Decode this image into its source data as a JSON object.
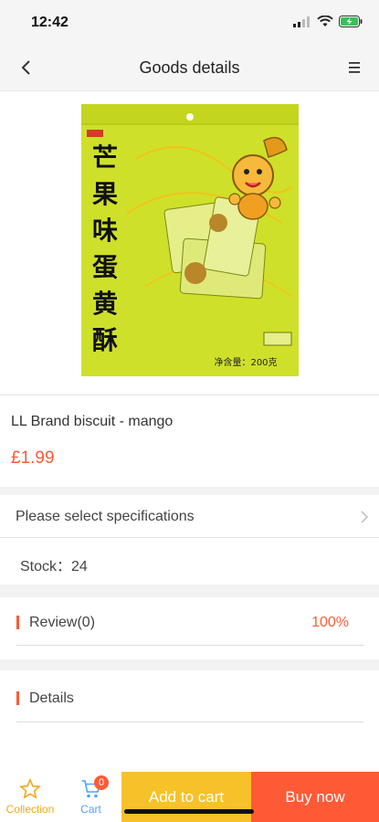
{
  "status_bar": {
    "time": "12:42"
  },
  "navbar": {
    "title": "Goods details",
    "back_icon": "chevron-left-icon",
    "menu_icon": "menu-icon"
  },
  "product": {
    "image_text": {
      "vertical_name": [
        "芒",
        "果",
        "味",
        "蛋",
        "黄",
        "酥"
      ],
      "weight": "净含量：200克"
    },
    "name": "LL Brand biscuit - mango",
    "price": "£1.99"
  },
  "specs": {
    "label": "Please select specifications",
    "stock": "Stock：24"
  },
  "review": {
    "label": "Review(0)",
    "rate": "100%"
  },
  "details": {
    "label": "Details"
  },
  "bottom_bar": {
    "collection_label": "Collection",
    "cart_label": "Cart",
    "cart_count": "0",
    "add_to_cart": "Add to cart",
    "buy_now": "Buy now"
  },
  "colors": {
    "accent": "#ff5a36",
    "add_button": "#f7c12a",
    "collection": "#f0a818",
    "cart": "#4aa3ff",
    "package": "#cfe02a"
  }
}
